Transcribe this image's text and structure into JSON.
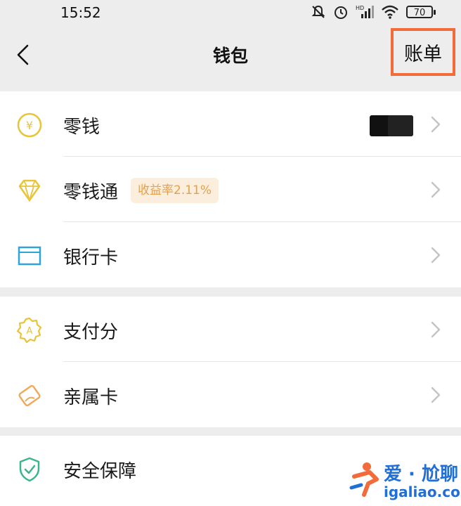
{
  "status_bar": {
    "time": "15:52",
    "battery": "70",
    "icons": [
      "notifications-off-icon",
      "alarm-icon",
      "hd-signal-icon",
      "wifi-icon",
      "battery-icon"
    ]
  },
  "nav": {
    "title": "钱包",
    "bill_label": "账单",
    "back_icon": "chevron-left-icon",
    "highlight_color": "#f26b3a"
  },
  "sections": [
    {
      "items": [
        {
          "label": "零钱",
          "icon": "yuan-coin-icon",
          "value_hidden": true
        },
        {
          "label": "零钱通",
          "icon": "diamond-icon",
          "badge": "收益率2.11%"
        },
        {
          "label": "银行卡",
          "icon": "bank-card-icon"
        }
      ]
    },
    {
      "items": [
        {
          "label": "支付分",
          "icon": "credit-score-icon"
        },
        {
          "label": "亲属卡",
          "icon": "family-card-icon"
        }
      ]
    },
    {
      "items": [
        {
          "label": "安全保障",
          "icon": "shield-check-icon"
        }
      ]
    }
  ],
  "watermark": {
    "text": "爱 · 尬聊",
    "url": "igaliao.com"
  },
  "colors": {
    "background": "#ededed",
    "yellow": "#e8c43a",
    "blue": "#2fa4d8",
    "green": "#3bb58a",
    "badge_bg": "#fbeedd",
    "badge_text": "#e5a04f"
  }
}
